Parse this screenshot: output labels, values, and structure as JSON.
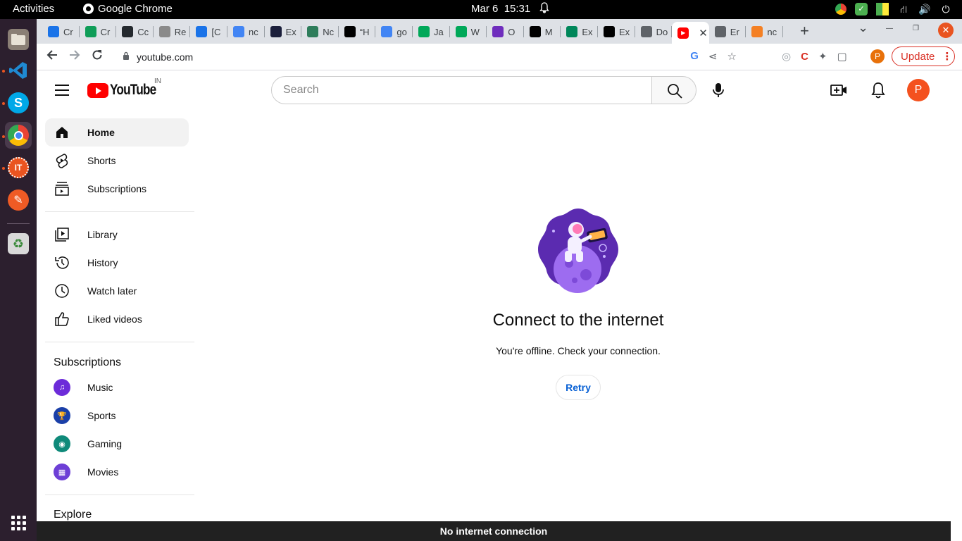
{
  "topbar": {
    "activities": "Activities",
    "app_name": "Google Chrome",
    "date": "Mar 6",
    "time": "15:31"
  },
  "dock": {
    "items": [
      {
        "name": "files-app",
        "icon": "folder-icon",
        "color": "#8a7f75"
      },
      {
        "name": "vscode-app",
        "icon": "vscode-icon",
        "color": "#1f7fd6"
      },
      {
        "name": "skype-app",
        "icon": "skype-icon",
        "color": "#00a8e8"
      },
      {
        "name": "chrome-app",
        "icon": "chrome-icon",
        "color": "#ffffff"
      },
      {
        "name": "it-app",
        "icon": "it-icon",
        "color": "#e95420"
      },
      {
        "name": "postman-app",
        "icon": "postman-icon",
        "color": "#ef5b25"
      },
      {
        "name": "trash",
        "icon": "trash-icon",
        "color": "#6b8f6b"
      }
    ]
  },
  "tabs": [
    {
      "label": "Cr",
      "color": "#1a73e8"
    },
    {
      "label": "Cr",
      "color": "#0f9d58"
    },
    {
      "label": "Cc",
      "color": "#24292e"
    },
    {
      "label": "Re",
      "color": "#8a8a8a"
    },
    {
      "label": "[C",
      "color": "#1a73e8"
    },
    {
      "label": "nc",
      "color": "#4285f4"
    },
    {
      "label": "Ex",
      "color": "#1b1f3b"
    },
    {
      "label": "Nc",
      "color": "#2e7d5b"
    },
    {
      "label": "“H",
      "color": "#000000"
    },
    {
      "label": "go",
      "color": "#4285f4"
    },
    {
      "label": "Ja",
      "color": "#00a859"
    },
    {
      "label": "W",
      "color": "#00a859"
    },
    {
      "label": "O",
      "color": "#6f2dbd"
    },
    {
      "label": "M",
      "color": "#000000"
    },
    {
      "label": "Ex",
      "color": "#00875a"
    },
    {
      "label": "Ex",
      "color": "#000000"
    },
    {
      "label": "Do",
      "color": "#5f6368"
    },
    {
      "label": "",
      "color": "#ff0000",
      "active": true
    },
    {
      "label": "Er",
      "color": "#5f6368"
    },
    {
      "label": "nc",
      "color": "#f48024"
    }
  ],
  "browser": {
    "url": "youtube.com",
    "update_label": "Update"
  },
  "youtube": {
    "logo_word": "YouTube",
    "country_code": "IN",
    "search_placeholder": "Search",
    "avatar_letter": "P"
  },
  "guide": {
    "main": [
      {
        "label": "Home",
        "icon": "home-icon",
        "active": true
      },
      {
        "label": "Shorts",
        "icon": "shorts-icon"
      },
      {
        "label": "Subscriptions",
        "icon": "subscriptions-icon"
      }
    ],
    "library": [
      {
        "label": "Library",
        "icon": "library-icon"
      },
      {
        "label": "History",
        "icon": "history-icon"
      },
      {
        "label": "Watch later",
        "icon": "watch-later-icon"
      },
      {
        "label": "Liked videos",
        "icon": "like-icon"
      }
    ],
    "subscriptions_heading": "Subscriptions",
    "subscriptions": [
      {
        "label": "Music",
        "icon": "music-channel-icon",
        "color": "#6c2bd9"
      },
      {
        "label": "Sports",
        "icon": "sports-channel-icon",
        "color": "#1a3fa8"
      },
      {
        "label": "Gaming",
        "icon": "gaming-channel-icon",
        "color": "#0f8a7a"
      },
      {
        "label": "Movies",
        "icon": "movies-channel-icon",
        "color": "#6d3fd6"
      }
    ],
    "explore_heading": "Explore"
  },
  "offline": {
    "title": "Connect to the internet",
    "subtitle": "You're offline. Check your connection.",
    "retry_label": "Retry"
  },
  "toast": {
    "message": "No internet connection"
  }
}
